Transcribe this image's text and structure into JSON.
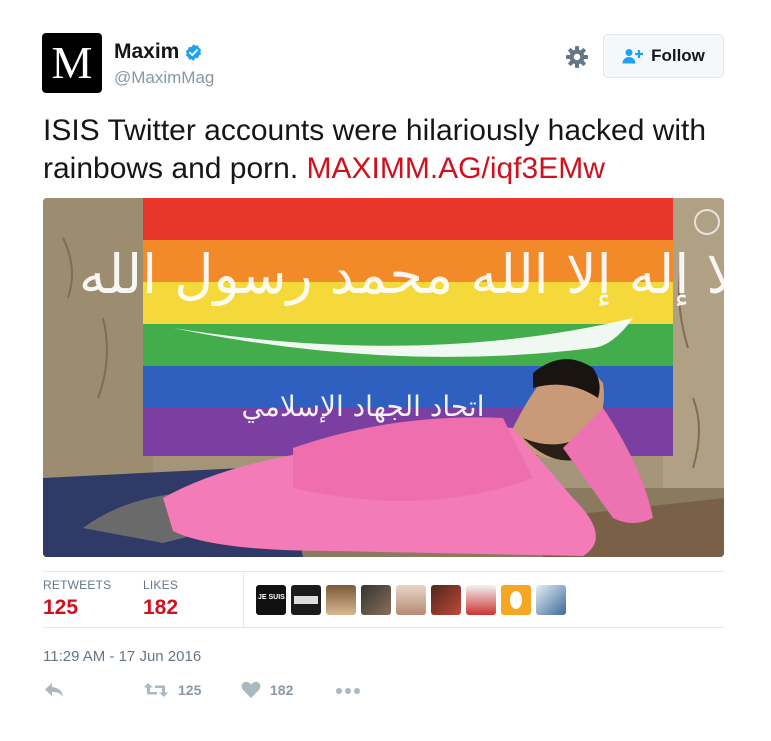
{
  "account": {
    "avatar_letter": "M",
    "display_name": "Maxim",
    "handle": "@MaximMag",
    "verified_icon": "verified-badge-icon"
  },
  "header": {
    "settings_icon": "gear-icon",
    "follow_label": "Follow",
    "follow_icon": "add-user-icon"
  },
  "tweet": {
    "text": "ISIS Twitter accounts were hilariously hacked with rainbows and porn. ",
    "link": "MAXIMM.AG/iqf3EMw"
  },
  "media": {
    "flag_script_large": "لا إله إلا الله محمد رسول الله",
    "flag_script_small": "اتحاد الجهاد الإسلامي"
  },
  "stats": {
    "retweets_label": "RETWEETS",
    "retweets_value": "125",
    "likes_label": "LIKES",
    "likes_value": "182"
  },
  "likers": {
    "first_avatar_text": "JE SUIS"
  },
  "timestamp": "11:29 AM - 17 Jun 2016",
  "actions": {
    "reply_icon": "reply-icon",
    "retweet_icon": "retweet-icon",
    "retweet_count": "125",
    "like_icon": "heart-icon",
    "like_count": "182",
    "more_icon": "more-dots-icon"
  },
  "colors": {
    "accent_red": "#d0101c",
    "verified_blue": "#1da1f2",
    "muted": "#8899a6"
  }
}
